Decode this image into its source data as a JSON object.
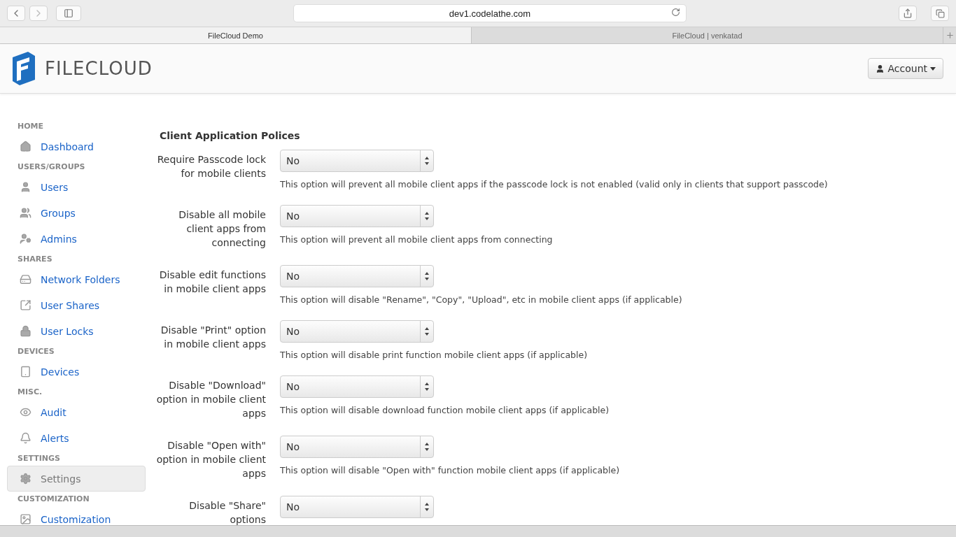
{
  "browser": {
    "url": "dev1.codelathe.com",
    "tabs": [
      {
        "label": "FileCloud Demo",
        "selected": true
      },
      {
        "label": "FileCloud | venkatad",
        "selected": false
      }
    ]
  },
  "header": {
    "logo_text": "FILECLOUD",
    "account_button": "Account"
  },
  "sidebar": {
    "sections": [
      {
        "heading": "HOME",
        "items": [
          {
            "label": "Dashboard",
            "selected": false
          }
        ]
      },
      {
        "heading": "USERS/GROUPS",
        "items": [
          {
            "label": "Users",
            "selected": false
          },
          {
            "label": "Groups",
            "selected": false
          },
          {
            "label": "Admins",
            "selected": false
          }
        ]
      },
      {
        "heading": "SHARES",
        "items": [
          {
            "label": "Network Folders",
            "selected": false
          },
          {
            "label": "User Shares",
            "selected": false
          },
          {
            "label": "User Locks",
            "selected": false
          }
        ]
      },
      {
        "heading": "DEVICES",
        "items": [
          {
            "label": "Devices",
            "selected": false
          }
        ]
      },
      {
        "heading": "MISC.",
        "items": [
          {
            "label": "Audit",
            "selected": false
          },
          {
            "label": "Alerts",
            "selected": false
          }
        ]
      },
      {
        "heading": "SETTINGS",
        "items": [
          {
            "label": "Settings",
            "selected": true
          }
        ]
      },
      {
        "heading": "CUSTOMIZATION",
        "items": [
          {
            "label": "Customization",
            "selected": false
          }
        ]
      }
    ]
  },
  "content": {
    "title": "Client Application Polices",
    "settings": [
      {
        "label": "Require Passcode lock for mobile clients",
        "value": "No",
        "description": "This option will prevent all mobile client apps if the passcode lock is not enabled (valid only in clients that support passcode)"
      },
      {
        "label": "Disable all mobile client apps from connecting",
        "value": "No",
        "description": "This option will prevent all mobile client apps from connecting"
      },
      {
        "label": "Disable edit functions in mobile client apps",
        "value": "No",
        "description": "This option will disable \"Rename\", \"Copy\", \"Upload\", etc in mobile client apps (if applicable)"
      },
      {
        "label": "Disable \"Print\" option in mobile client apps",
        "value": "No",
        "description": "This option will disable print function mobile client apps (if applicable)"
      },
      {
        "label": "Disable \"Download\" option in mobile client apps",
        "value": "No",
        "description": "This option will disable download function mobile client apps (if applicable)"
      },
      {
        "label": "Disable \"Open with\" option in mobile client apps",
        "value": "No",
        "description": "This option will disable \"Open with\" function mobile client apps (if applicable)"
      },
      {
        "label": "Disable \"Share\" options",
        "value": "No"
      }
    ]
  }
}
